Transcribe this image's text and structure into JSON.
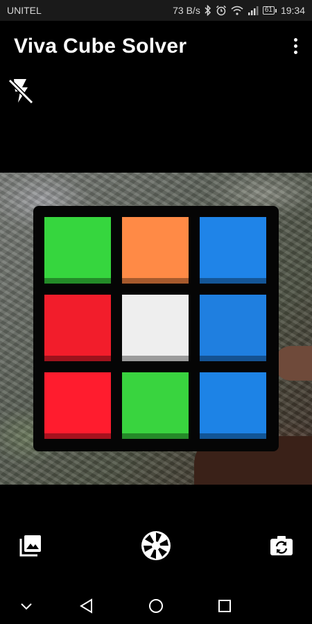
{
  "status_bar": {
    "carrier": "UNITEL",
    "net_speed": "73 B/s",
    "battery": "61",
    "time": "19:34",
    "icons": [
      "bluetooth-icon",
      "alarm-icon",
      "wifi-icon",
      "signal-icon",
      "battery-icon"
    ]
  },
  "app_bar": {
    "title": "Viva Cube Solver",
    "menu_icon": "more-vert-icon"
  },
  "camera": {
    "flash_icon": "flash-off-icon",
    "cube_face": [
      [
        "#36d63e",
        "#ff8a46",
        "#1f84e8"
      ],
      [
        "#f21d2b",
        "#eeeeee",
        "#1f7fe0"
      ],
      [
        "#ff1c2e",
        "#39d43f",
        "#1d83e6"
      ]
    ]
  },
  "controls": {
    "gallery_icon": "photo-library-icon",
    "shutter_icon": "camera-shutter-icon",
    "switch_icon": "switch-camera-icon"
  },
  "system_nav": [
    "chevron-down-icon",
    "back-triangle-icon",
    "home-circle-icon",
    "recents-square-icon"
  ]
}
